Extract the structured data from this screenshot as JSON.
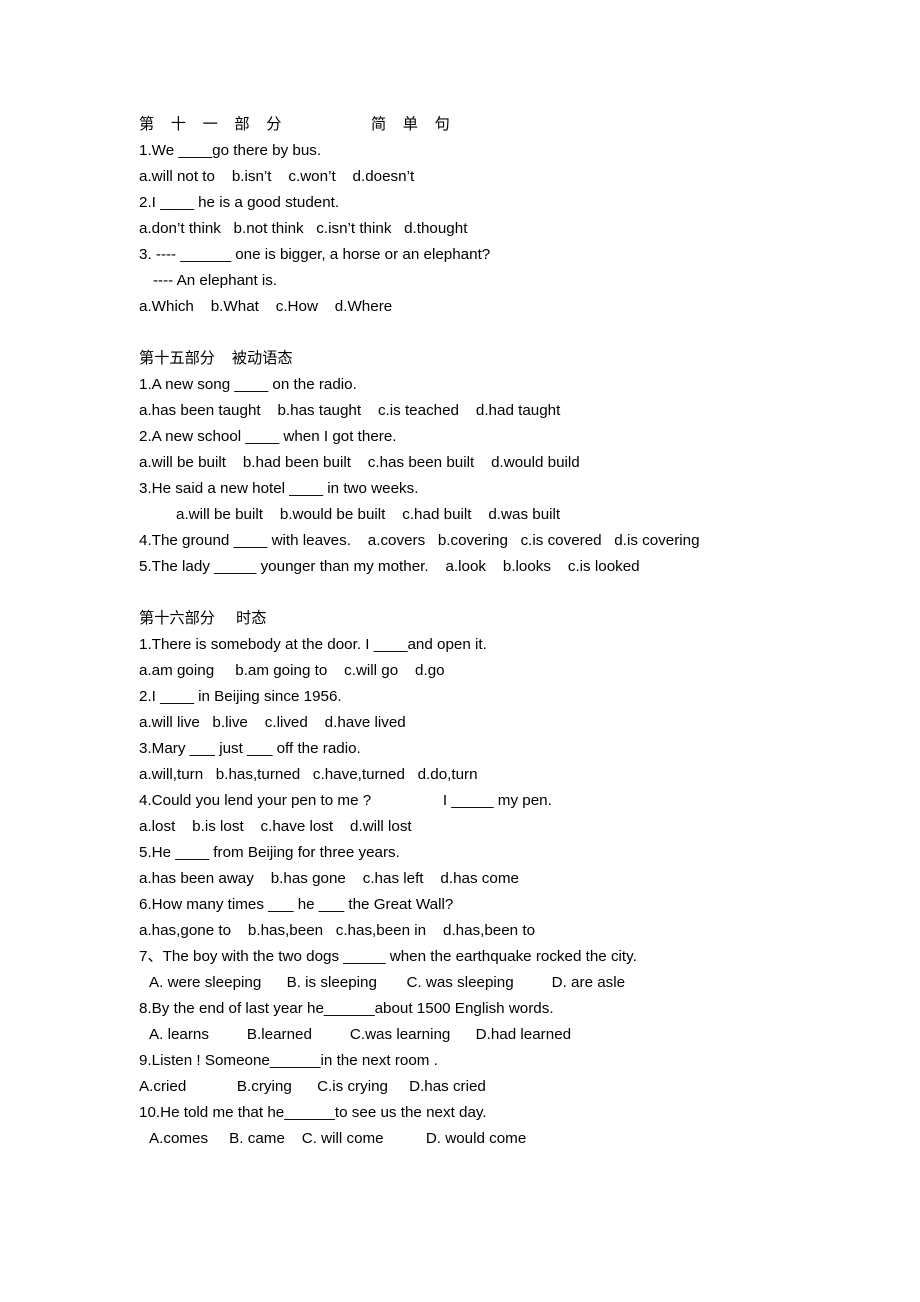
{
  "document": {
    "sections": [
      {
        "id": "part-11",
        "title": "第 十 一 部 分        简 单 句",
        "title_spaced": true,
        "lines": [
          {
            "text": "1.We ____go there by bus.",
            "indent": 0
          },
          {
            "text": "a.will not to    b.isn’t    c.won’t    d.doesn’t",
            "indent": 0
          },
          {
            "text": "2.I ____ he is a good student.",
            "indent": 0
          },
          {
            "text": "a.don’t think   b.not think   c.isn’t think   d.thought",
            "indent": 0
          },
          {
            "text": "3. ---- ______ one is bigger, a horse or an elephant?",
            "indent": 0
          },
          {
            "text": "---- An elephant is.",
            "indent": 1
          },
          {
            "text": "a.Which    b.What    c.How    d.Where",
            "indent": 0
          }
        ]
      },
      {
        "id": "part-15",
        "title": "第十五部分    被动语态",
        "title_spaced": false,
        "lines": [
          {
            "text": "1.A new song ____ on the radio.",
            "indent": 0
          },
          {
            "text": "a.has been taught    b.has taught    c.is teached    d.had taught",
            "indent": 0
          },
          {
            "text": "2.A new school ____ when I got there.",
            "indent": 0
          },
          {
            "text": "a.will be built    b.had been built    c.has been built    d.would build",
            "indent": 0
          },
          {
            "text": "3.He said a new hotel ____ in two weeks.",
            "indent": 0
          },
          {
            "text": "a.will be built    b.would be built    c.had built    d.was built",
            "indent": 2
          },
          {
            "text": "4.The ground ____ with leaves.    a.covers   b.covering   c.is covered   d.is covering",
            "indent": 0
          },
          {
            "text": "5.The lady _____ younger than my mother.    a.look    b.looks    c.is looked",
            "indent": 0
          }
        ]
      },
      {
        "id": "part-16",
        "title": "第十六部分     时态",
        "title_spaced": false,
        "lines": [
          {
            "text": "1.There is somebody at the door. I ____and open it.",
            "indent": 0
          },
          {
            "text": "a.am going     b.am going to    c.will go    d.go",
            "indent": 0
          },
          {
            "text": "2.I ____ in Beijing since 1956.",
            "indent": 0
          },
          {
            "text": "a.will live   b.live    c.lived    d.have lived",
            "indent": 0
          },
          {
            "text": "3.Mary ___ just ___ off the radio.",
            "indent": 0
          },
          {
            "text": "a.will,turn   b.has,turned   c.have,turned   d.do,turn",
            "indent": 0
          },
          {
            "text": "4.Could you lend your pen to me ?                 I _____ my pen.",
            "indent": 0
          },
          {
            "text": "a.lost    b.is lost    c.have lost    d.will lost",
            "indent": 0
          },
          {
            "text": "5.He ____ from Beijing for three years.",
            "indent": 0
          },
          {
            "text": "a.has been away    b.has gone    c.has left    d.has come",
            "indent": 0
          },
          {
            "text": "6.How many times ___ he ___ the Great Wall?",
            "indent": 0
          },
          {
            "text": "a.has,gone to    b.has,been   c.has,been in    d.has,been to",
            "indent": 0
          },
          {
            "text": "7、The boy with the two dogs _____ when the earthquake rocked the city.",
            "indent": 0
          },
          {
            "text": "A. were sleeping      B. is sleeping       C. was sleeping         D. are asle",
            "indent": 3
          },
          {
            "text": "8.By the end of last year he______about 1500 English words.",
            "indent": 0
          },
          {
            "text": "A. learns         B.learned         C.was learning      D.had learned",
            "indent": 3
          },
          {
            "text": "9.Listen ! Someone______in the next room .",
            "indent": 0
          },
          {
            "text": "A.cried            B.crying      C.is crying     D.has cried",
            "indent": 0
          },
          {
            "text": "10.He told me that he______to see us the next day.",
            "indent": 0
          },
          {
            "text": "A.comes     B. came    C. will come          D. would come",
            "indent": 3
          }
        ]
      }
    ]
  }
}
